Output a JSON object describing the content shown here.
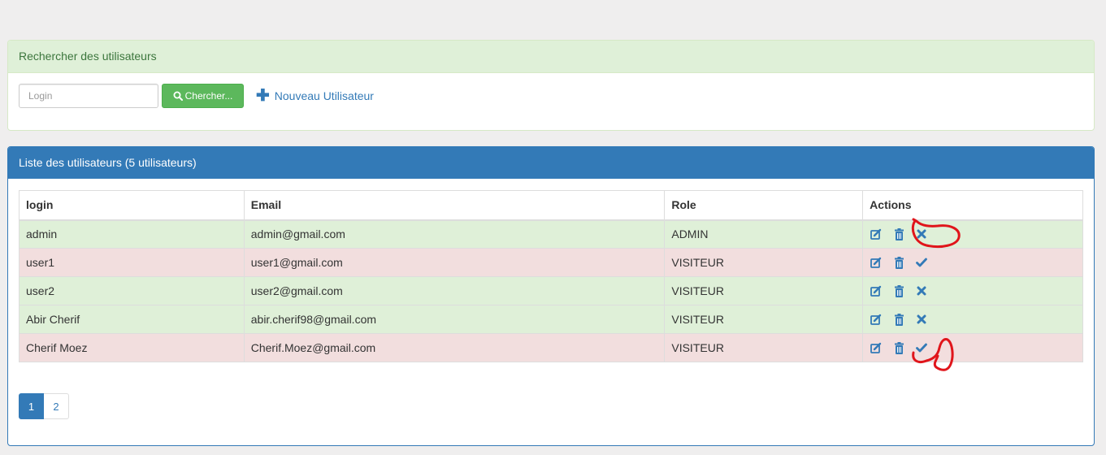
{
  "search_panel": {
    "title": "Rechercher des utilisateurs",
    "login_placeholder": "Login",
    "search_button_label": "Chercher...",
    "new_user_label": "Nouveau Utilisateur"
  },
  "list_panel": {
    "title": "Liste des utilisateurs (5 utilisateurs)",
    "columns": [
      "login",
      "Email",
      "Role",
      "Actions"
    ],
    "rows": [
      {
        "login": "admin",
        "email": "admin@gmail.com",
        "role": "ADMIN",
        "status": "active",
        "toggle_icon": "times-icon"
      },
      {
        "login": "user1",
        "email": "user1@gmail.com",
        "role": "VISITEUR",
        "status": "inactive",
        "toggle_icon": "check-icon"
      },
      {
        "login": "user2",
        "email": "user2@gmail.com",
        "role": "VISITEUR",
        "status": "active",
        "toggle_icon": "times-icon"
      },
      {
        "login": "Abir Cherif",
        "email": "abir.cherif98@gmail.com",
        "role": "VISITEUR",
        "status": "active",
        "toggle_icon": "times-icon"
      },
      {
        "login": "Cherif Moez",
        "email": "Cherif.Moez@gmail.com",
        "role": "VISITEUR",
        "status": "inactive",
        "toggle_icon": "check-icon"
      }
    ]
  },
  "pagination": {
    "pages": [
      "1",
      "2"
    ],
    "current": "1"
  },
  "colors": {
    "primary": "#337ab7",
    "success": "#5cb85c",
    "row_active": "#dff0d8",
    "row_inactive": "#f2dede",
    "annotation": "#e0151b"
  }
}
